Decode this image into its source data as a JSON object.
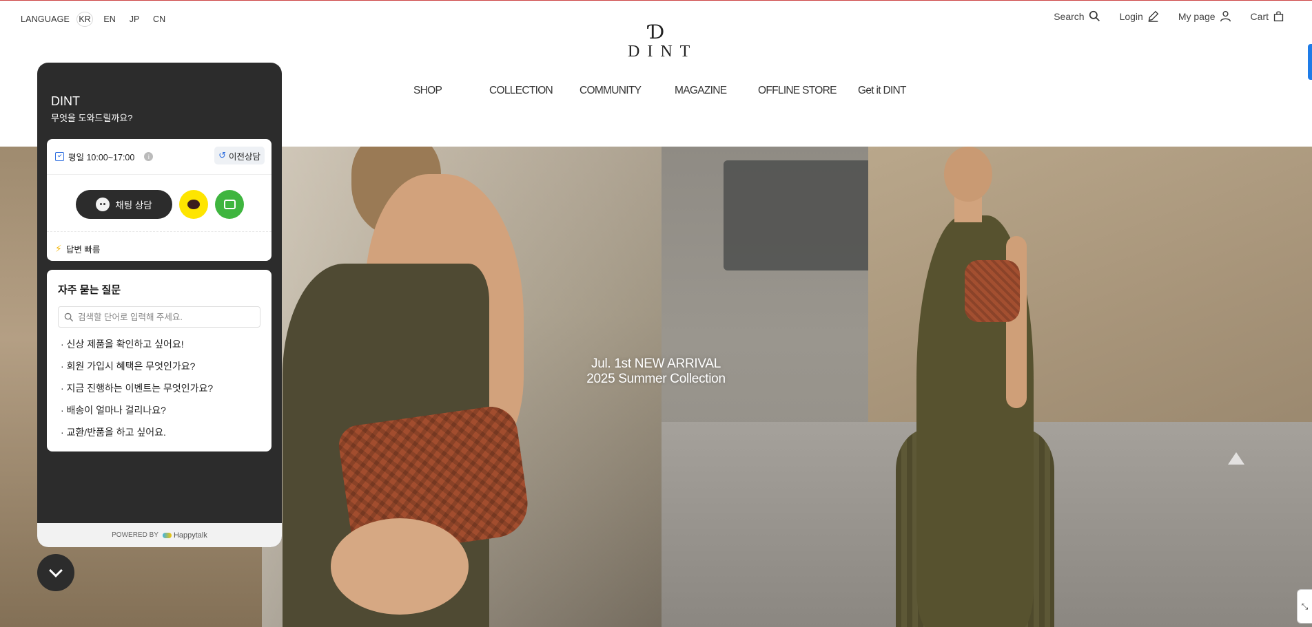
{
  "language": {
    "label": "LANGUAGE",
    "options": [
      "KR",
      "EN",
      "JP",
      "CN"
    ],
    "selected": "KR"
  },
  "utility": {
    "search": "Search",
    "login": "Login",
    "mypage": "My page",
    "cart": "Cart"
  },
  "logo": {
    "mark": "Ɗ",
    "word": "DINT"
  },
  "nav": [
    "SHOP",
    "COLLECTION",
    "COMMUNITY",
    "MAGAZINE",
    "OFFLINE STORE",
    "Get it DINT"
  ],
  "hero": {
    "line1": "Jul. 1st NEW ARRIVAL",
    "line2": "2025 Summer Collection"
  },
  "chat": {
    "brand": "DINT",
    "greeting": "무엇을 도와드릴까요?",
    "hours": "평일 10:00~17:00",
    "previous": "이전상담",
    "chat_button": "채팅 상담",
    "fast_reply": "답변 빠름",
    "faq_title": "자주 묻는 질문",
    "faq_placeholder": "검색할 단어로 입력해 주세요.",
    "faq": [
      "· 신상 제품을 확인하고 싶어요!",
      "· 회원 가입시 혜택은 무엇인가요?",
      "· 지금 진행하는 이벤트는 무엇인가요?",
      "· 배송이 얼마나 걸리나요?",
      "· 교환/반품을 하고 싶어요."
    ],
    "powered_by": "POWERED BY",
    "provider": "Happytalk"
  },
  "colors": {
    "accent_blue": "#1e7ce8",
    "chat_dark": "#2c2c2c",
    "kakao_yellow": "#fee500",
    "talk_green": "#3fb53f"
  }
}
